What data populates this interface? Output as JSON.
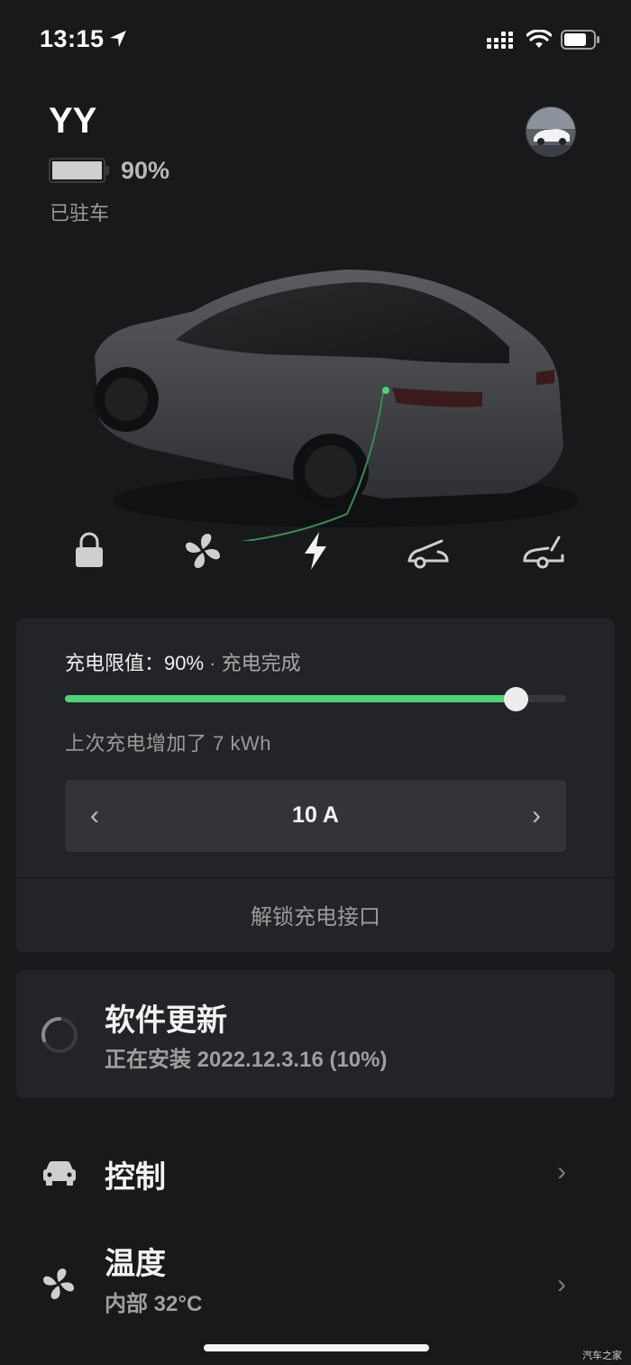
{
  "status_bar": {
    "time": "13:15"
  },
  "vehicle": {
    "name": "YY",
    "battery_percent": "90%",
    "status": "已驻车"
  },
  "quick_controls": [
    "lock-icon",
    "fan-icon",
    "charge-bolt-icon",
    "frunk-icon",
    "trunk-icon"
  ],
  "charge": {
    "limit_label": "充电限值：90%",
    "separator": " · ",
    "state": "充电完成",
    "limit_level": 0.9,
    "last_session": "上次充电增加了 7 kWh",
    "amps": "10 A",
    "prev_glyph": "‹",
    "next_glyph": "›",
    "unlock_port": "解锁充电接口"
  },
  "software_update": {
    "title": "软件更新",
    "detail": "正在安装 2022.12.3.16 (10%)"
  },
  "menu": {
    "controls": {
      "label": "控制",
      "chevron": "›"
    },
    "climate": {
      "label": "温度",
      "detail": "内部 32°C",
      "chevron": "›"
    }
  },
  "watermark": "汽车之家",
  "colors": {
    "background": "#18191b",
    "card": "#232427",
    "accent_green": "#4fd175"
  }
}
